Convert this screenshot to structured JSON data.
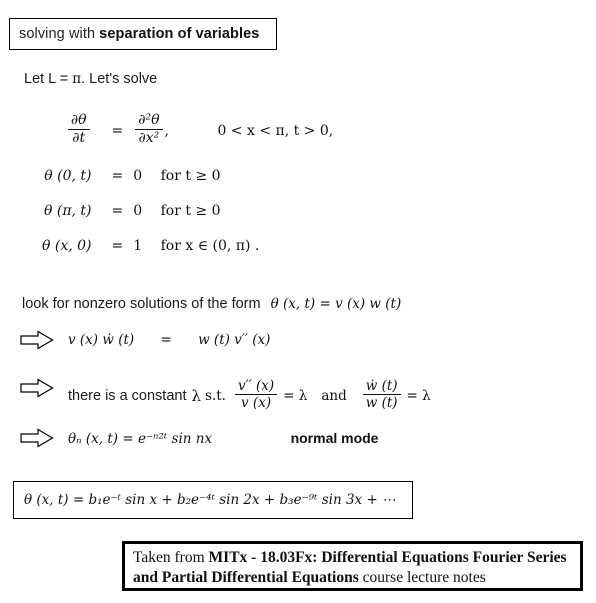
{
  "title_box": {
    "text_normal": "solving with",
    "text_bold": "separation of variables"
  },
  "intro": {
    "text_pre": "Let L = ",
    "symbol": "π",
    "text_post": ". Let's solve"
  },
  "pde_system": {
    "rows": [
      {
        "lhs_num": "∂θ",
        "lhs_den": "∂t",
        "equals": "=",
        "rhs_num": "∂²θ",
        "rhs_den": "∂x²",
        "rhs_tail": ",",
        "condition": "0 < x < π,  t > 0,"
      },
      {
        "lhs": "θ (0, t)",
        "equals": "=",
        "rhs": "0",
        "condition": "for t ≥ 0"
      },
      {
        "lhs": "θ (π, t)",
        "equals": "=",
        "rhs": "0",
        "condition": "for t ≥ 0"
      },
      {
        "lhs": "θ (x, 0)",
        "equals": "=",
        "rhs": "1",
        "condition": "for x ∈ (0, π) ."
      }
    ]
  },
  "ansatz": {
    "label": "look for nonzero solutions of the form",
    "equation": "θ (x, t) = v (x) w (t)"
  },
  "step1": {
    "arrow_icon": "block-arrow-right-icon",
    "lhs": "v (x) ẇ (t)",
    "equals": "=",
    "rhs": "w (t) v′′ (x)"
  },
  "step2": {
    "arrow_icon": "block-arrow-right-icon",
    "text": "there is a constant",
    "lambda": "λ",
    "st": "s.t.",
    "frac1_num": "v′′ (x)",
    "frac1_den": "v (x)",
    "frac1_value": "= λ",
    "conjunction": "and",
    "frac2_num": "ẇ (t)",
    "frac2_den": "w (t)",
    "frac2_value": "= λ"
  },
  "step3": {
    "arrow_icon": "block-arrow-right-icon",
    "equation": "θₙ (x, t) = e⁻ⁿ²ᵗ sin nx",
    "annotation": "normal mode"
  },
  "result_box": {
    "equation": "θ (x, t) = b₁e⁻ᵗ sin x + b₂e⁻⁴ᵗ sin 2x + b₃e⁻⁹ᵗ sin 3x + ⋯"
  },
  "attribution": {
    "prefix": "Taken from ",
    "bold": "MITx - 18.03Fx: Differential Equations Fourier Series and Partial Differential Equations",
    "suffix": " course lecture notes"
  },
  "colors": {
    "text": "#1a1a1a",
    "border": "#000000",
    "background": "#ffffff"
  }
}
